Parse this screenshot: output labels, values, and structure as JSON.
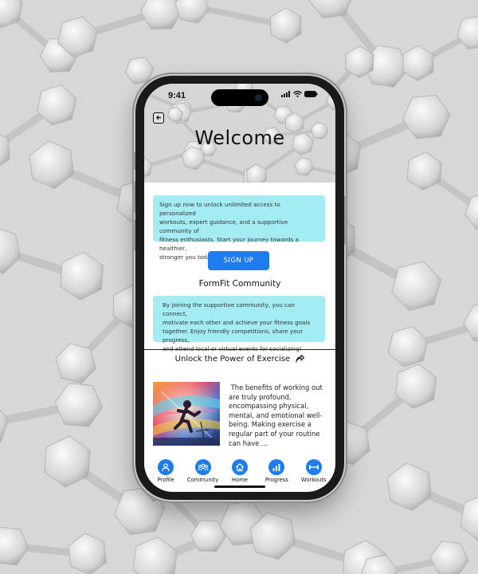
{
  "status_bar": {
    "time": "9:41"
  },
  "header": {
    "title": "Welcome",
    "back_icon": "back-arrow-icon"
  },
  "signup_card": {
    "lines": [
      "Sign up now to unlock unlimited access to personalized",
      "workouts, expert guidance, and a supportive community of",
      "fitness enthusiasts. Start your journey towards a healthier,",
      "stronger you today!"
    ]
  },
  "signup_button": {
    "label": "SIGN UP"
  },
  "community": {
    "title": "FormFit Community",
    "lines": [
      "By joining the supportive community, you can connect,",
      "motivate each other and achieve your fitness goals",
      "together. Enjoy friendly competitions, share your progress,",
      "and attend local or virtual events for socializing!"
    ]
  },
  "article": {
    "title": "Unlock the Power of Exercise",
    "share_icon": "share-arrow-icon",
    "lines": [
      " The benefits of working out",
      "are truly profound,",
      "encompassing physical,",
      "mental, and emotional well-",
      "being. Making exercise a",
      "regular part of your routine",
      "can have ..."
    ]
  },
  "tabs": [
    {
      "label": "Profile",
      "icon": "person-icon"
    },
    {
      "label": "Community",
      "icon": "group-icon"
    },
    {
      "label": "Home",
      "icon": "home-icon"
    },
    {
      "label": "Progress",
      "icon": "bar-chart-icon"
    },
    {
      "label": "Workouts",
      "icon": "dumbbell-icon"
    }
  ],
  "colors": {
    "accent": "#1c7cf0",
    "card_bg": "#a3ecf4",
    "background": "#dcdcdc"
  }
}
